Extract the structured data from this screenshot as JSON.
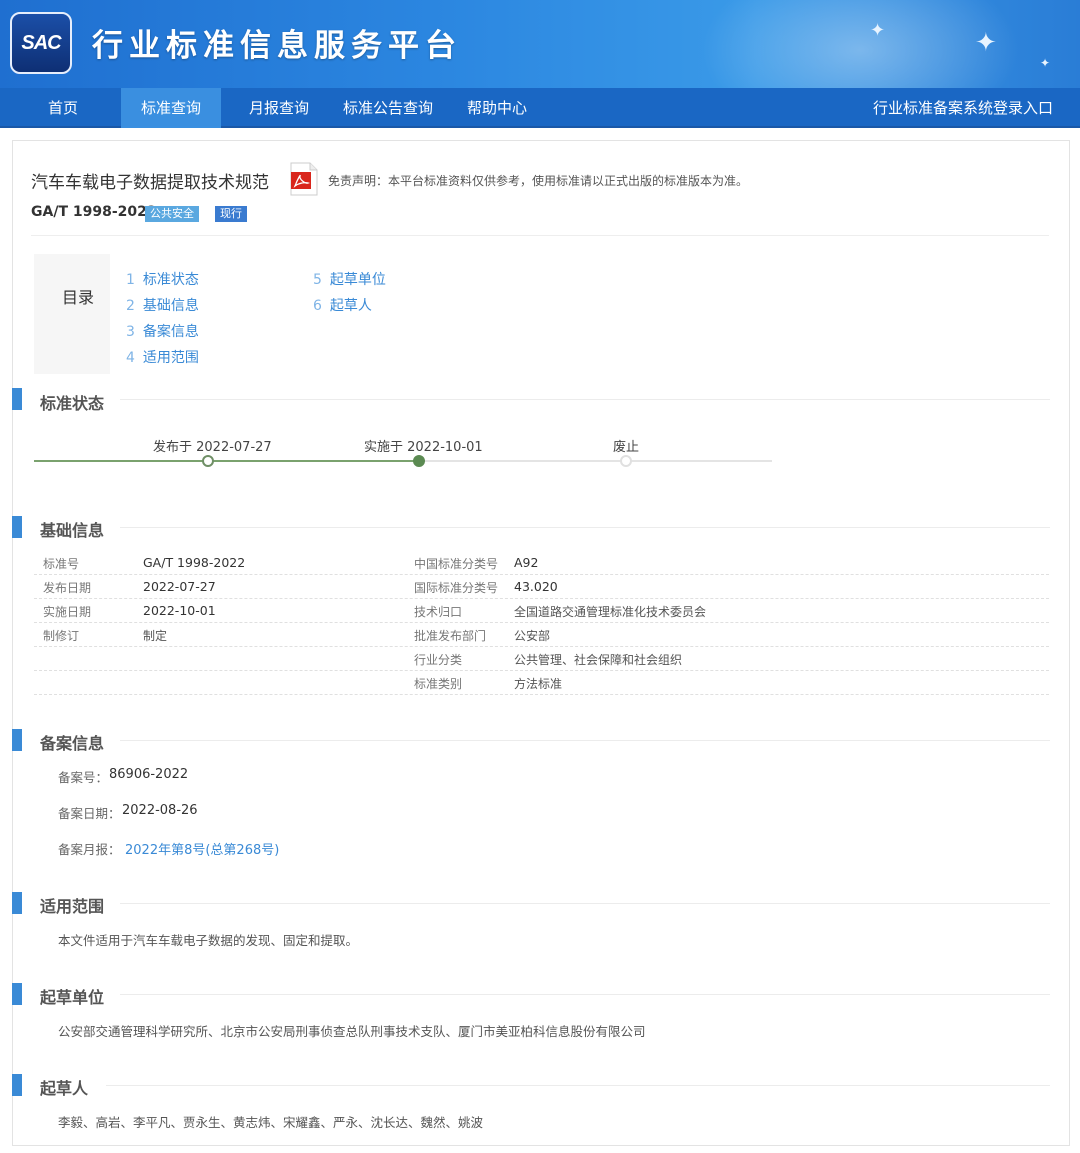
{
  "header": {
    "logo_text": "SAC",
    "site_title": "行业标准信息服务平台"
  },
  "nav": {
    "items": [
      "首页",
      "标准查询",
      "月报查询",
      "标准公告查询",
      "帮助中心"
    ],
    "active": "标准查询",
    "login": "行业标准备案系统登录入口"
  },
  "document": {
    "title": "汽车车载电子数据提取技术规范",
    "code": "GA/T 1998-2022",
    "badges": [
      "公共安全",
      "现行"
    ],
    "disclaimer": "免责声明：本平台标准资料仅供参考，使用标准请以正式出版的标准版本为准。"
  },
  "toc": {
    "label": "目录",
    "items": [
      {
        "num": "1",
        "label": "标准状态"
      },
      {
        "num": "2",
        "label": "基础信息"
      },
      {
        "num": "3",
        "label": "备案信息"
      },
      {
        "num": "4",
        "label": "适用范围"
      },
      {
        "num": "5",
        "label": "起草单位"
      },
      {
        "num": "6",
        "label": "起草人"
      }
    ]
  },
  "status": {
    "title": "标准状态",
    "published": "发布于 2022-07-27",
    "implemented": "实施于 2022-10-01",
    "abolished": "废止"
  },
  "basic": {
    "title": "基础信息",
    "left": [
      {
        "k": "标准号",
        "v": "GA/T 1998-2022"
      },
      {
        "k": "发布日期",
        "v": "2022-07-27"
      },
      {
        "k": "实施日期",
        "v": "2022-10-01"
      },
      {
        "k": "制修订",
        "v": "制定"
      }
    ],
    "right": [
      {
        "k": "中国标准分类号",
        "v": "A92"
      },
      {
        "k": "国际标准分类号",
        "v": "43.020"
      },
      {
        "k": "技术归口",
        "v": "全国道路交通管理标准化技术委员会"
      },
      {
        "k": "批准发布部门",
        "v": "公安部"
      },
      {
        "k": "行业分类",
        "v": "公共管理、社会保障和社会组织"
      },
      {
        "k": "标准类别",
        "v": "方法标准"
      }
    ]
  },
  "record": {
    "title": "备案信息",
    "no_label": "备案号：",
    "no_value": "86906-2022",
    "date_label": "备案日期：",
    "date_value": "2022-08-26",
    "report_label": "备案月报：",
    "report_link": "2022年第8号(总第268号)"
  },
  "scope": {
    "title": "适用范围",
    "text": "本文件适用于汽车车载电子数据的发现、固定和提取。"
  },
  "drafting_units": {
    "title": "起草单位",
    "text": "公安部交通管理科学研究所、北京市公安局刑事侦查总队刑事技术支队、厦门市美亚柏科信息股份有限公司"
  },
  "drafters": {
    "title": "起草人",
    "text": "李毅、高岩、李平凡、贾永生、黄志炜、宋耀鑫、严永、沈长达、魏然、姚波"
  }
}
